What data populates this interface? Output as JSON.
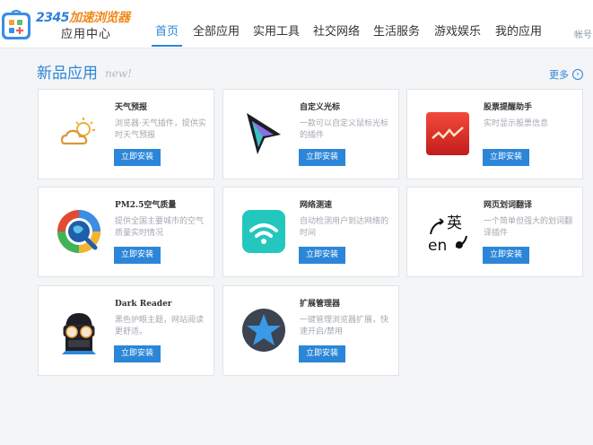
{
  "header": {
    "logo_brand_blue": "2345",
    "logo_brand_orange": "加速浏览器",
    "logo_subtitle": "应用中心",
    "nav": [
      "首页",
      "全部应用",
      "实用工具",
      "社交网络",
      "生活服务",
      "游戏娱乐",
      "我的应用"
    ],
    "active_nav": "首页",
    "right_text": "帐号"
  },
  "section": {
    "title": "新品应用",
    "badge": "new!",
    "more_label": "更多",
    "more_icon_glyph": "›"
  },
  "apps": [
    {
      "name": "天气预报",
      "desc": "浏览器·天气插件，提供实时天气预报",
      "button": "立即安装",
      "icon": "weather-icon"
    },
    {
      "name": "自定义光标",
      "desc": "一款可以自定义鼠标光标的插件",
      "button": "立即安装",
      "icon": "cursor-icon"
    },
    {
      "name": "股票提醒助手",
      "desc": "实时显示股票信息",
      "button": "立即安装",
      "icon": "stock-chart-icon"
    },
    {
      "name": "PM2.5空气质量",
      "desc": "提供全国主要城市的空气质量实时情况",
      "button": "立即安装",
      "icon": "air-quality-icon"
    },
    {
      "name": "网络测速",
      "desc": "自动检测用户到达网络的时间",
      "button": "立即安装",
      "icon": "wifi-icon"
    },
    {
      "name": "网页划词翻译",
      "desc": "一个简单但强大的划词翻译插件",
      "button": "立即安装",
      "icon": "translate-icon"
    },
    {
      "name": "Dark Reader",
      "desc": "黑色护眼主题，网站阅读更舒适。",
      "button": "立即安装",
      "icon": "dark-reader-icon"
    },
    {
      "name": "扩展管理器",
      "desc": "一键管理浏览器扩展，快速开启/禁用",
      "button": "立即安装",
      "icon": "star-icon"
    }
  ],
  "colors": {
    "accent": "#2b86d8",
    "brand_orange": "#f08a1c"
  }
}
